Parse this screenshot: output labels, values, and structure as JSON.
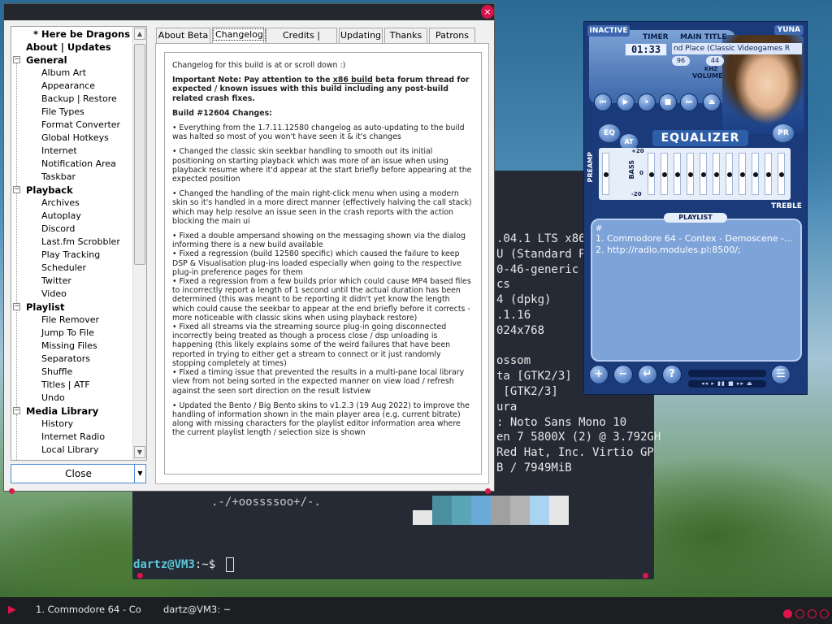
{
  "dialog": {
    "close_glyph": "×",
    "close_button": "Close",
    "tree": [
      {
        "label": "* Here be Dragons *",
        "kind": "top"
      },
      {
        "label": "About | Updates",
        "kind": "top"
      },
      {
        "label": "General",
        "kind": "cat"
      },
      {
        "label": "Album Art",
        "kind": "item"
      },
      {
        "label": "Appearance",
        "kind": "item"
      },
      {
        "label": "Backup | Restore",
        "kind": "item"
      },
      {
        "label": "File Types",
        "kind": "item"
      },
      {
        "label": "Format Converter",
        "kind": "item"
      },
      {
        "label": "Global Hotkeys",
        "kind": "item"
      },
      {
        "label": "Internet",
        "kind": "item"
      },
      {
        "label": "Notification Area",
        "kind": "item"
      },
      {
        "label": "Taskbar",
        "kind": "item"
      },
      {
        "label": "Playback",
        "kind": "cat"
      },
      {
        "label": "Archives",
        "kind": "item"
      },
      {
        "label": "Autoplay",
        "kind": "item"
      },
      {
        "label": "Discord",
        "kind": "item"
      },
      {
        "label": "Last.fm Scrobbler",
        "kind": "item"
      },
      {
        "label": "Play Tracking",
        "kind": "item"
      },
      {
        "label": "Scheduler",
        "kind": "item"
      },
      {
        "label": "Twitter",
        "kind": "item"
      },
      {
        "label": "Video",
        "kind": "item"
      },
      {
        "label": "Playlist",
        "kind": "cat"
      },
      {
        "label": "File Remover",
        "kind": "item"
      },
      {
        "label": "Jump To File",
        "kind": "item"
      },
      {
        "label": "Missing Files",
        "kind": "item"
      },
      {
        "label": "Separators",
        "kind": "item"
      },
      {
        "label": "Shuffle",
        "kind": "item"
      },
      {
        "label": "Titles | ATF",
        "kind": "item"
      },
      {
        "label": "Undo",
        "kind": "item"
      },
      {
        "label": "Media Library",
        "kind": "cat"
      },
      {
        "label": "History",
        "kind": "item"
      },
      {
        "label": "Internet Radio",
        "kind": "item"
      },
      {
        "label": "Local Library",
        "kind": "item"
      }
    ],
    "tabs": [
      "About Beta",
      "Changelog",
      "Credits | Licenses",
      "Updating",
      "Thanks",
      "Patrons"
    ],
    "active_tab": 1,
    "changelog": {
      "intro": "Changelog for this build is at  or scroll down :)",
      "note_prefix": "Important Note: Pay attention to the ",
      "note_link": "x86 build",
      "note_suffix": " beta forum thread for expected / known issues with this build including any post-build related crash fixes.",
      "build_heading": "Build #12604 Changes:",
      "items": [
        "• Everything from the 1.7.11.12580 changelog as auto-updating to the build was halted so most of you won't have seen it & it's changes",
        "• Changed the classic skin seekbar handling to smooth out its initial positioning on starting playback which was more of an issue when using playback resume where it'd appear at the start briefly before appearing at the expected position",
        "• Changed the handling of the main right-click menu when using a modern skin so it's handled in a more direct manner (effectively halving the call stack) which may help resolve an issue seen in the crash reports with the action blocking the main ui",
        "• Fixed a double ampersand showing on the messaging shown via the dialog informing there is a new build available\n• Fixed a regression (build 12580 specific) which caused the failure to keep DSP & Visualisation plug-ins loaded especially when going to the respective plug-in preference pages for them\n• Fixed a regression from a few builds prior which could cause MP4 based files to incorrectly report a length of 1 second until the actual duration has been determined (this was meant to be reporting it didn't yet know the length which could cause the seekbar to appear at the end briefly before it corrects - more noticeable with classic skins when using playback restore)\n• Fixed all streams via the streaming source plug-in going disconnected incorrectly being treated as though a process close / dsp unloading is happening (this likely explains some of the weird failures that have been reported in trying to either get a stream to connect or it just randomly stopping completely at times)\n• Fixed a timing issue that prevented the results in a multi-pane local library view from not being sorted in the expected manner on view load / refresh against the seen sort direction on the result listview",
        "• Updated the Bento / Big Bento skins to v1.2.3 (19 Aug 2022) to improve the handling of information shown in the main player area (e.g. current bitrate) along with missing characters for the playlist editor information area where the current playlist length / selection size is shown"
      ]
    }
  },
  "terminal": {
    "lines": [
      ".04.1 LTS x86_",
      "U (Standard PC",
      "0-46-generic",
      "cs",
      "4 (dpkg)",
      ".1.16",
      "024x768",
      "",
      "ossom",
      "ta [GTK2/3]",
      " [GTK2/3]",
      "ura",
      ": Noto Sans Mono 10",
      "en 7 5800X (2) @ 3.792GH",
      "Red Hat, Inc. Virtio GP",
      "B / 7949MiB"
    ],
    "logo_line": ".-/+oossssoo+/-.",
    "prompt_user": "dartz@VM3",
    "prompt_rest": ":~$ ",
    "palette": [
      "#e6e6e6",
      "#4a8ea0",
      "#5aa6b8",
      "#6aaad8",
      "#a0a0a0",
      "#b4b4b4",
      "#a8d4f0",
      "#e6e6e6"
    ]
  },
  "winamp": {
    "inactive": "INACTIVE",
    "skin_name": "YUNA",
    "timer_label": "TIMER",
    "title_label": "MAIN TITLE",
    "time": "01:33",
    "song": "nd Place (Classic Videogames R",
    "kbps": "96",
    "khz": "44",
    "khz_label": "KHZ",
    "volume_label": "VOLUME",
    "eq_title": "EQUALIZER",
    "eq_btn": "EQ",
    "at_btn": "AT",
    "pr_btn": "PR",
    "preamp_label": "PREAMP",
    "bass_label": "BASS",
    "treble_label": "TREBLE",
    "db_plus": "+20",
    "db_zero": "0",
    "db_minus": "-20",
    "eq_levels": [
      0.0,
      0.0,
      0.0,
      0.0,
      0.0,
      0.0,
      0.0,
      0.0,
      0.0,
      0.0,
      0.0
    ],
    "preamp_level": 0.0,
    "playlist_label": "PLAYLIST",
    "playlist_hash": "#",
    "playlist": [
      "1. Commodore 64 - Contex - Demoscene -...",
      "2. http://radio.modules.pl:8500/;"
    ],
    "pl_buttons": [
      "+",
      "−",
      "↵",
      "?",
      "☰"
    ]
  },
  "taskbar": {
    "play_glyph": "▶",
    "items": [
      "1. Commodore 64 - Co",
      "dartz@VM3: ~"
    ]
  }
}
